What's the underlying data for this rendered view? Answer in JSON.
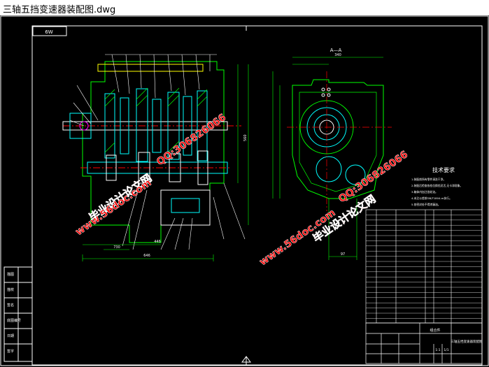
{
  "window": {
    "title": "三轴五挡变速器装配图.dwg"
  },
  "drawing": {
    "colors": {
      "background": "#000000",
      "frame": "#ffffff",
      "green": "#00ff00",
      "cyan": "#00ffff",
      "red": "#ff0000",
      "yellow": "#ffff00",
      "magenta": "#ff00ff"
    },
    "corner_tag": "6W",
    "section_label": "A—A",
    "dims": {
      "overall_length": "646",
      "base_length": "446",
      "section_width": "340",
      "right_height": "97",
      "bottom_left": "730",
      "side_height": "560"
    },
    "tech_requirements": {
      "title": "技术要求",
      "items": [
        "1.装配前所有零件清洗干净。",
        "2.装配后检查各档位换挡灵活,无卡滞现象。",
        "3.箱体内加注齿轮油。",
        "4.未注公差按GB/T1804-m执行。",
        "5.各密封处不得渗漏油。"
      ]
    },
    "side_stamps": [
      "描图",
      "描校",
      "签名",
      "底图编号",
      "日期",
      "签字"
    ],
    "title_block": {
      "name": "三轴五挡变速器装配图",
      "material": "组合件",
      "scale": "1:1",
      "sheet": "1/1"
    },
    "watermarks": [
      {
        "text": "毕业设计论文网"
      },
      {
        "text": "QQ:306826066"
      },
      {
        "text": "www.56doc.com"
      },
      {
        "text": "毕业设计论文网"
      },
      {
        "text": "QQ:306826066"
      },
      {
        "text": "www.56doc.com"
      }
    ]
  }
}
